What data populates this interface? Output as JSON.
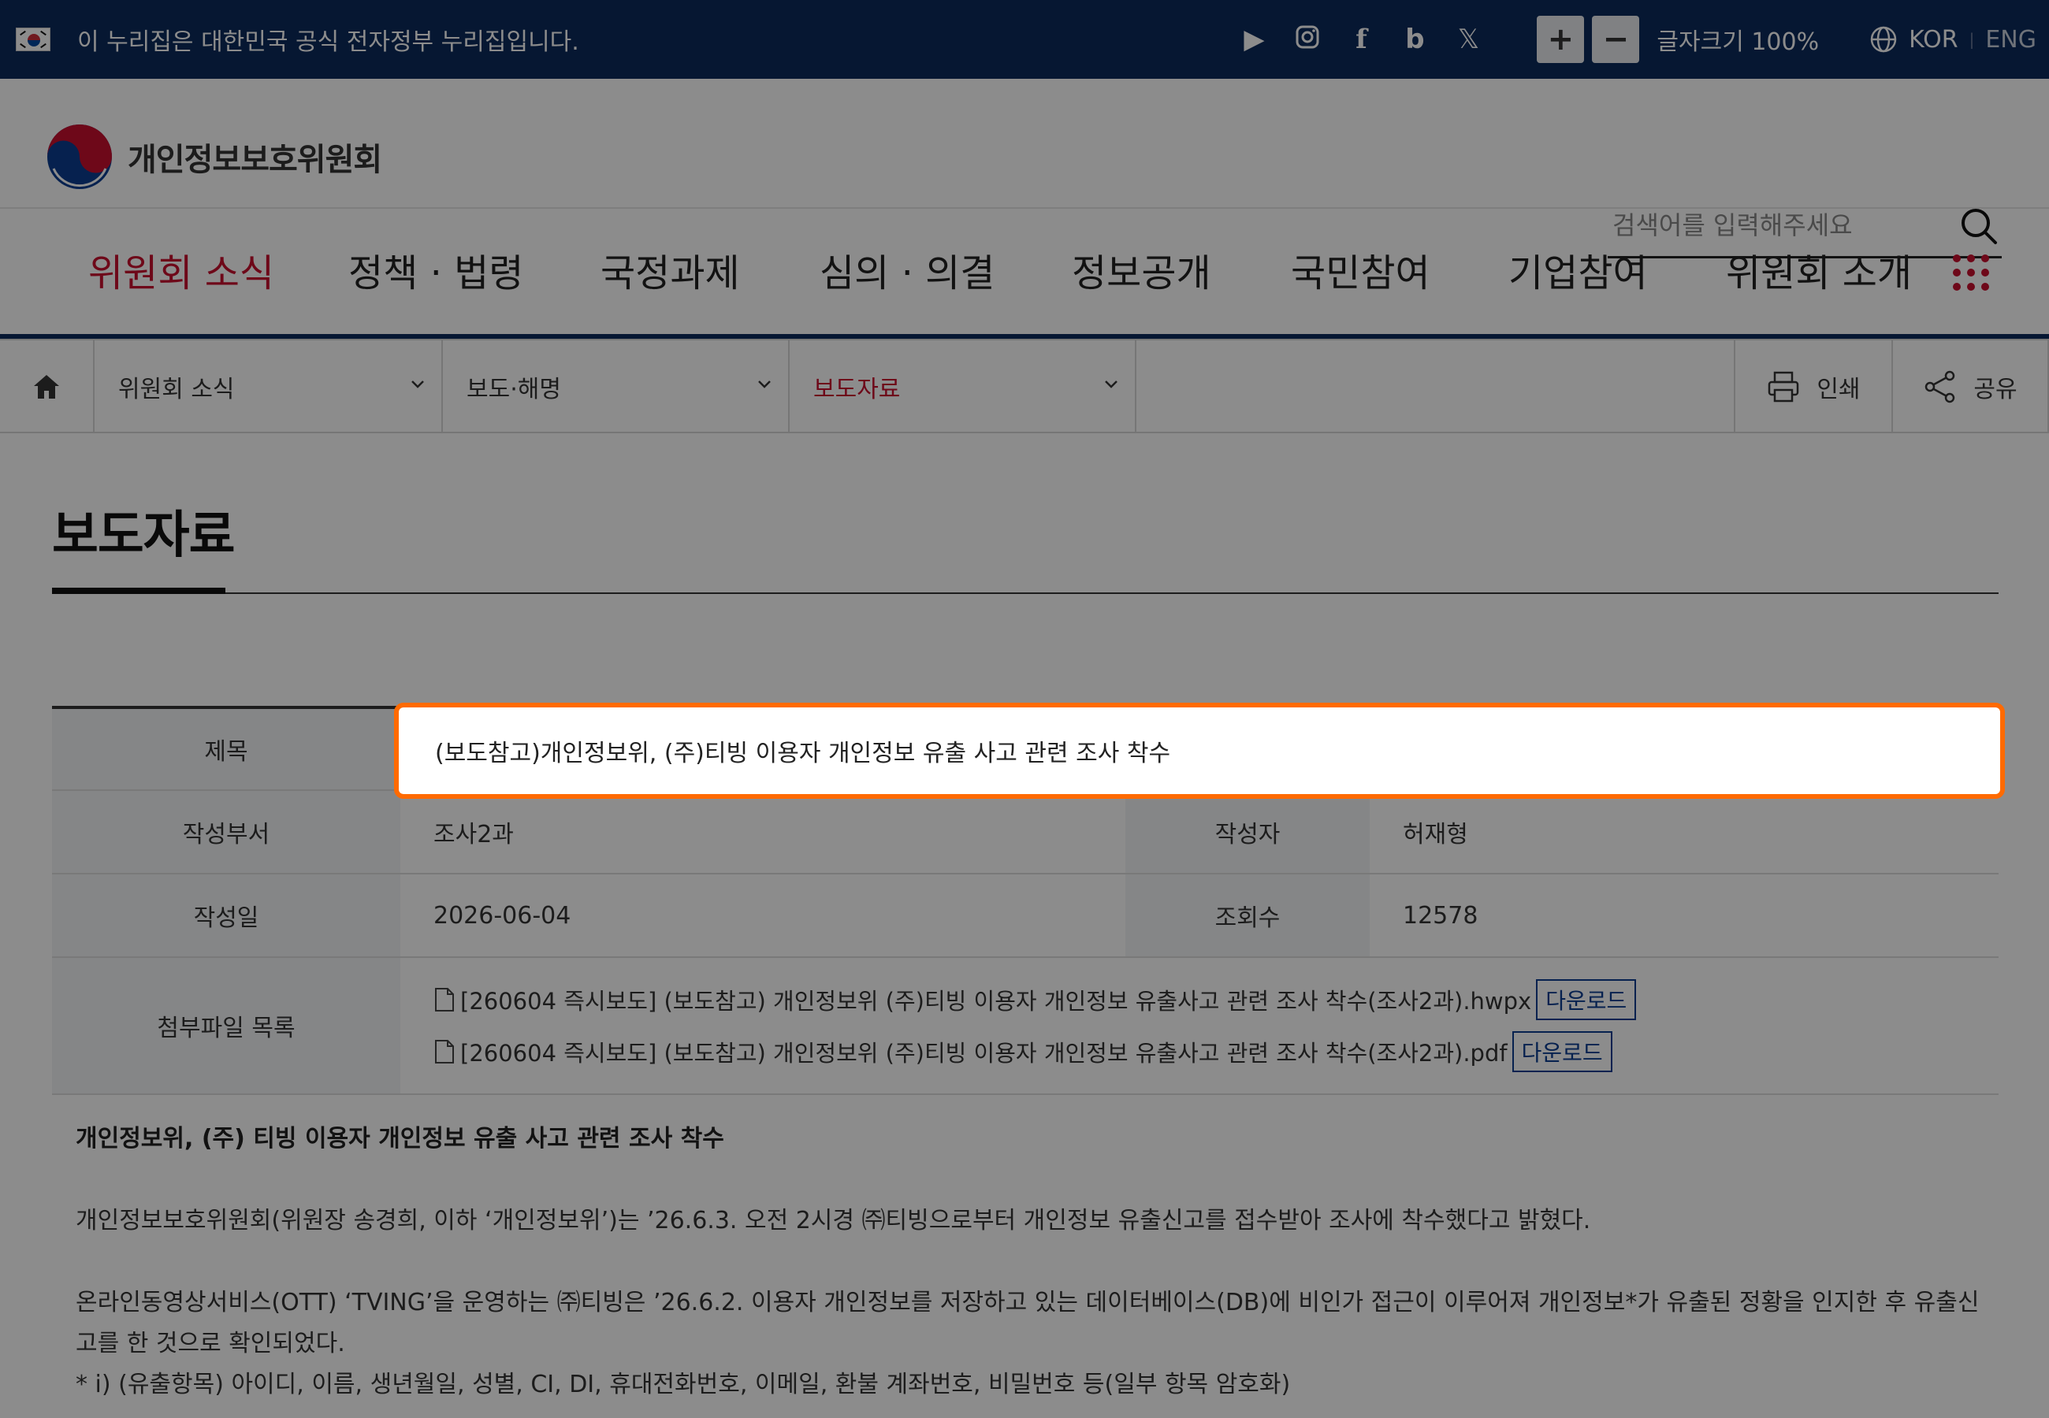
{
  "gov_bar": {
    "notice": "이 누리집은 대한민국 공식 전자정부 누리집입니다.",
    "font_size_plus": "+",
    "font_size_minus": "−",
    "font_size_label": "글자크기 100%",
    "lang_kor": "KOR",
    "lang_sep": "|",
    "lang_eng": "ENG"
  },
  "header": {
    "logo_text": "개인정보보호위원회",
    "search_placeholder": "검색어를 입력해주세요"
  },
  "gnb": {
    "items": [
      "위원회 소식",
      "정책 · 법령",
      "국정과제",
      "심의 · 의결",
      "정보공개",
      "국민참여",
      "기업참여",
      "위원회 소개"
    ]
  },
  "location": {
    "depth1": "위원회 소식",
    "depth2": "보도·해명",
    "depth3": "보도자료",
    "print": "인쇄",
    "share": "공유"
  },
  "page": {
    "title": "보도자료"
  },
  "article": {
    "labels": {
      "title": "제목",
      "dept": "작성부서",
      "author": "작성자",
      "date": "작성일",
      "views": "조회수",
      "attachments": "첨부파일 목록"
    },
    "title": "(보도참고)개인정보위, (주)티빙 이용자 개인정보 유출 사고 관련 조사 착수",
    "dept": "조사2과",
    "author": "허재형",
    "date": "2026-06-04",
    "views": "12578",
    "attachments": [
      {
        "name": "[260604 즉시보도] (보도참고) 개인정보위 (주)티빙 이용자 개인정보 유출사고 관련 조사 착수(조사2과).hwpx",
        "button": "다운로드"
      },
      {
        "name": "[260604 즉시보도] (보도참고) 개인정보위 (주)티빙 이용자 개인정보 유출사고 관련 조사 착수(조사2과).pdf",
        "button": "다운로드"
      }
    ],
    "body": {
      "headline": "개인정보위, (주) 티빙 이용자 개인정보 유출 사고 관련 조사 착수",
      "p1": "개인정보보호위원회(위원장 송경희, 이하 ‘개인정보위’)는 ’26.6.3. 오전 2시경 ㈜티빙으로부터 개인정보 유출신고를 접수받아 조사에 착수했다고 밝혔다.",
      "p2": "온라인동영상서비스(OTT) ‘TVING’을 운영하는 ㈜티빙은 ’26.6.2. 이용자 개인정보를 저장하고 있는 데이터베이스(DB)에 비인가 접근이 이루어져 개인정보*가 유출된 정황을 인지한 후 유출신고를 한 것으로 확인되었다.",
      "p3": "  *  ⅰ) (유출항목) 아이디, 이름, 생년월일, 성별, CI, DI, 휴대전화번호, 이메일, 환불 계좌번호, 비밀번호 등(일부 항목 암호화)"
    }
  }
}
